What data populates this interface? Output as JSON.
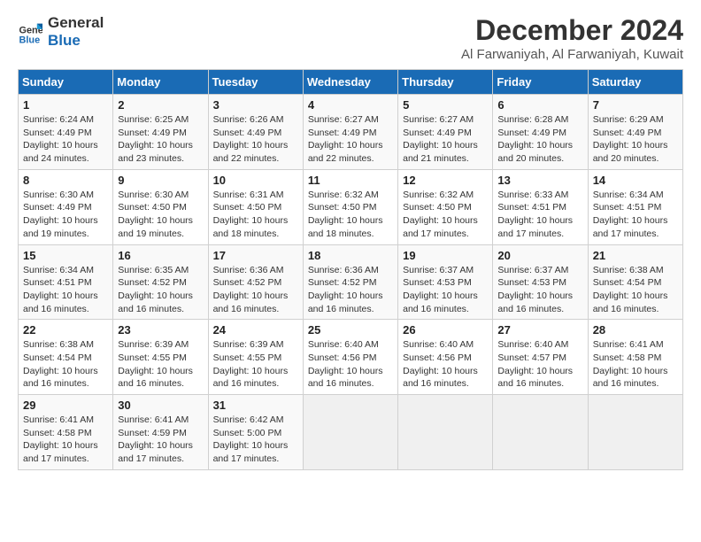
{
  "logo": {
    "line1": "General",
    "line2": "Blue"
  },
  "title": "December 2024",
  "location": "Al Farwaniyah, Al Farwaniyah, Kuwait",
  "weekdays": [
    "Sunday",
    "Monday",
    "Tuesday",
    "Wednesday",
    "Thursday",
    "Friday",
    "Saturday"
  ],
  "weeks": [
    [
      {
        "day": 1,
        "sunrise": "6:24 AM",
        "sunset": "4:49 PM",
        "daylight": "10 hours and 24 minutes."
      },
      {
        "day": 2,
        "sunrise": "6:25 AM",
        "sunset": "4:49 PM",
        "daylight": "10 hours and 23 minutes."
      },
      {
        "day": 3,
        "sunrise": "6:26 AM",
        "sunset": "4:49 PM",
        "daylight": "10 hours and 22 minutes."
      },
      {
        "day": 4,
        "sunrise": "6:27 AM",
        "sunset": "4:49 PM",
        "daylight": "10 hours and 22 minutes."
      },
      {
        "day": 5,
        "sunrise": "6:27 AM",
        "sunset": "4:49 PM",
        "daylight": "10 hours and 21 minutes."
      },
      {
        "day": 6,
        "sunrise": "6:28 AM",
        "sunset": "4:49 PM",
        "daylight": "10 hours and 20 minutes."
      },
      {
        "day": 7,
        "sunrise": "6:29 AM",
        "sunset": "4:49 PM",
        "daylight": "10 hours and 20 minutes."
      }
    ],
    [
      {
        "day": 8,
        "sunrise": "6:30 AM",
        "sunset": "4:49 PM",
        "daylight": "10 hours and 19 minutes."
      },
      {
        "day": 9,
        "sunrise": "6:30 AM",
        "sunset": "4:50 PM",
        "daylight": "10 hours and 19 minutes."
      },
      {
        "day": 10,
        "sunrise": "6:31 AM",
        "sunset": "4:50 PM",
        "daylight": "10 hours and 18 minutes."
      },
      {
        "day": 11,
        "sunrise": "6:32 AM",
        "sunset": "4:50 PM",
        "daylight": "10 hours and 18 minutes."
      },
      {
        "day": 12,
        "sunrise": "6:32 AM",
        "sunset": "4:50 PM",
        "daylight": "10 hours and 17 minutes."
      },
      {
        "day": 13,
        "sunrise": "6:33 AM",
        "sunset": "4:51 PM",
        "daylight": "10 hours and 17 minutes."
      },
      {
        "day": 14,
        "sunrise": "6:34 AM",
        "sunset": "4:51 PM",
        "daylight": "10 hours and 17 minutes."
      }
    ],
    [
      {
        "day": 15,
        "sunrise": "6:34 AM",
        "sunset": "4:51 PM",
        "daylight": "10 hours and 16 minutes."
      },
      {
        "day": 16,
        "sunrise": "6:35 AM",
        "sunset": "4:52 PM",
        "daylight": "10 hours and 16 minutes."
      },
      {
        "day": 17,
        "sunrise": "6:36 AM",
        "sunset": "4:52 PM",
        "daylight": "10 hours and 16 minutes."
      },
      {
        "day": 18,
        "sunrise": "6:36 AM",
        "sunset": "4:52 PM",
        "daylight": "10 hours and 16 minutes."
      },
      {
        "day": 19,
        "sunrise": "6:37 AM",
        "sunset": "4:53 PM",
        "daylight": "10 hours and 16 minutes."
      },
      {
        "day": 20,
        "sunrise": "6:37 AM",
        "sunset": "4:53 PM",
        "daylight": "10 hours and 16 minutes."
      },
      {
        "day": 21,
        "sunrise": "6:38 AM",
        "sunset": "4:54 PM",
        "daylight": "10 hours and 16 minutes."
      }
    ],
    [
      {
        "day": 22,
        "sunrise": "6:38 AM",
        "sunset": "4:54 PM",
        "daylight": "10 hours and 16 minutes."
      },
      {
        "day": 23,
        "sunrise": "6:39 AM",
        "sunset": "4:55 PM",
        "daylight": "10 hours and 16 minutes."
      },
      {
        "day": 24,
        "sunrise": "6:39 AM",
        "sunset": "4:55 PM",
        "daylight": "10 hours and 16 minutes."
      },
      {
        "day": 25,
        "sunrise": "6:40 AM",
        "sunset": "4:56 PM",
        "daylight": "10 hours and 16 minutes."
      },
      {
        "day": 26,
        "sunrise": "6:40 AM",
        "sunset": "4:56 PM",
        "daylight": "10 hours and 16 minutes."
      },
      {
        "day": 27,
        "sunrise": "6:40 AM",
        "sunset": "4:57 PM",
        "daylight": "10 hours and 16 minutes."
      },
      {
        "day": 28,
        "sunrise": "6:41 AM",
        "sunset": "4:58 PM",
        "daylight": "10 hours and 16 minutes."
      }
    ],
    [
      {
        "day": 29,
        "sunrise": "6:41 AM",
        "sunset": "4:58 PM",
        "daylight": "10 hours and 17 minutes."
      },
      {
        "day": 30,
        "sunrise": "6:41 AM",
        "sunset": "4:59 PM",
        "daylight": "10 hours and 17 minutes."
      },
      {
        "day": 31,
        "sunrise": "6:42 AM",
        "sunset": "5:00 PM",
        "daylight": "10 hours and 17 minutes."
      },
      null,
      null,
      null,
      null
    ]
  ],
  "labels": {
    "sunrise": "Sunrise:",
    "sunset": "Sunset:",
    "daylight": "Daylight:"
  }
}
